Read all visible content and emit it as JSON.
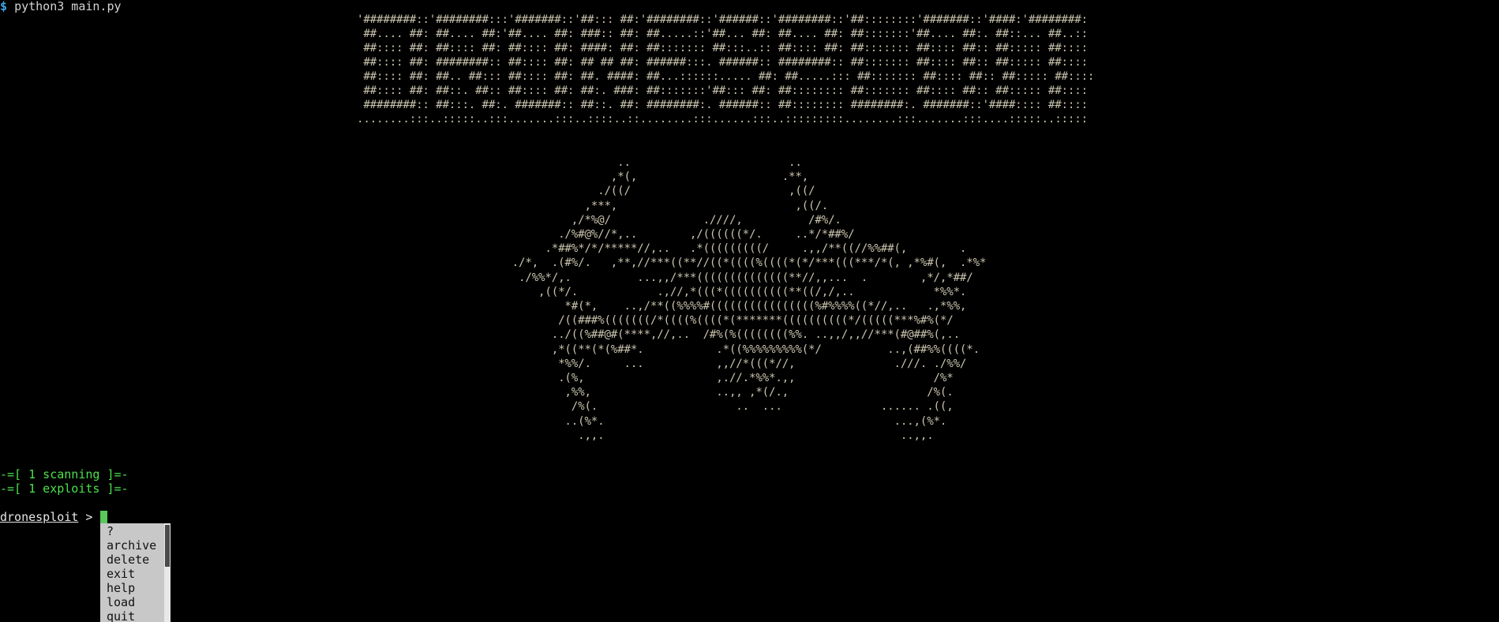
{
  "terminal": {
    "prompt_symbol": "$",
    "command": "python3 main.py"
  },
  "banner_art": "'########::'########:::'#######::'##::: ##:'########::'######::'########::'##::::::::'#######::'####:'########:\n ##.... ##: ##.... ##:'##.... ##: ###:: ##: ##.....::'##... ##: ##.... ##: ##:::::::'##.... ##:. ##::... ##..::\n ##:::: ##: ##:::: ##: ##:::: ##: ####: ##: ##::::::: ##:::..:: ##:::: ##: ##::::::: ##:::: ##:: ##::::: ##::::\n ##:::: ##: ########:: ##:::: ##: ## ## ##: ######:::. ######:: ########:: ##::::::: ##:::: ##:: ##::::: ##::::\n ##:::: ##: ##.. ##::: ##:::: ##: ##. ####: ##...::::::..... ##: ##.....::: ##::::::: ##:::: ##:: ##::::: ##::::\n ##:::: ##: ##::. ##:: ##:::: ##: ##:. ###: ##:::::::'##::: ##: ##:::::::: ##::::::: ##:::: ##:: ##::::: ##::::\n ########:: ##:::. ##:. #######:: ##::. ##: ########:. ######:: ##:::::::: ########:. #######::'####:::: ##::::\n........:::..:::::..:::.......:::..::::..::........:::......:::..:::::::::........:::.......:::....:::::..:::::",
  "drone_art": "                  ..                        ..\n                 ,*(,                      .**,\n               ./((/                        ,((/\n             ,***,                           ,((/.\n           ,/*%@/              .////,          /#%/.\n         ./%#@%//*,..        ,/((((((*/.     ..*/*##%/\n       .*##%*/*/*****//,..   .*(((((((((/     .,,/**((//%%##(,        .\n  ./*,  .(#%/.   ,**,//***((**//((*((((%((((*(*/***(((***/*(, ,*%#(,  .*%*\n   ./%%*/,.          ...,,/***((((((((((((((**//,,...  .        ,*/,*##/\n      ,((*/.            .,//,*(((*((((((((((**((/,/,..            *%%*.\n          *#(*,    ..,/**((%%%%#((((((((((((((((%#%%%%((*//,..   .,*%%,\n         /((###%(((((((/*((((%((((*(*******((((((((((*/(((((***%#%(*/\n        ../((%##@#(****,//,..  /#%(%((((((((%%. ..,,/,,//***(#@##%(,..\n        ,*((**(*(%##*.           .*((%%%%%%%%%(*/          ..,(##%%((((*.\n         *%%/.     ...           ,,//*(((*//,               .///. ./%%/\n         .(%,                    ,.//.*%%*.,,                     /%*\n          ,%%,                   ..,, ,*(/.,                     /%(.\n           /%(.                     ..  ...               ...... .((,\n          ..(%*.                                            ...,(%*.\n            .,,.                                             ..,,.",
  "status": {
    "scanning": "-=[ 1 scanning ]=-",
    "exploits": "-=[ 1 exploits ]=-"
  },
  "prompt": {
    "name": "dronesploit",
    "separator": " >"
  },
  "completion_menu": {
    "items": [
      "?",
      "archive",
      "delete",
      "exit",
      "help",
      "load",
      "quit"
    ]
  },
  "colors": {
    "background": "#000000",
    "prompt_symbol": "#3fa6e8",
    "status_text": "#4ce24c",
    "ascii_art": "#c9c3ad",
    "cursor": "#5ac85a",
    "menu_background": "#c8c8c8"
  }
}
